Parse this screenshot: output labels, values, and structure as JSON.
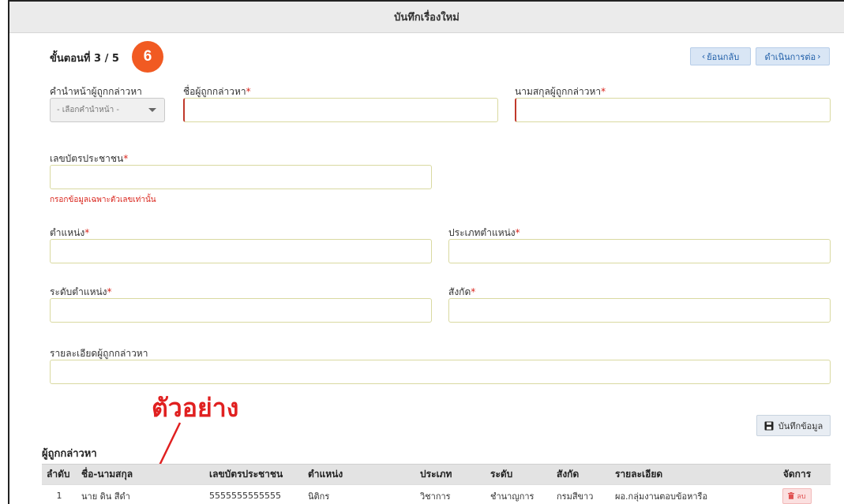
{
  "window": {
    "title": "บันทึกเรื่องใหม่"
  },
  "step": {
    "label": "ขั้นตอนที่ 3 / 5",
    "badge": "6"
  },
  "nav": {
    "back_label": "ย้อนกลับ",
    "next_label": "ดำเนินการต่อ"
  },
  "form": {
    "prefix_label": "คำนำหน้าผู้ถูกกล่าวหา",
    "prefix_placeholder": "- เลือกคำนำหน้า -",
    "firstname_label": "ชื่อผู้ถูกกล่าวหา",
    "lastname_label": "นามสกุลผู้ถูกกล่าวหา",
    "idcard_label": "เลขบัตรประชาชน",
    "idcard_hint": "กรอกข้อมูลเฉพาะตัวเลขเท่านั้น",
    "position_label": "ตำแหน่ง",
    "position_type_label": "ประเภทตำแหน่ง",
    "level_label": "ระดับตำแหน่ง",
    "affiliation_label": "สังกัด",
    "detail_label": "รายละเอียดผู้ถูกกล่าวหา",
    "required_mark": "*",
    "save_label": "บันทึกข้อมูล"
  },
  "annotation": {
    "text": "ตัวอย่าง",
    "color": "#e02020"
  },
  "accused": {
    "section_title": "ผู้ถูกกล่าวหา",
    "columns": [
      "ลำดับ",
      "ชื่อ-นามสกุล",
      "เลขบัตรประชาชน",
      "ตำแหน่ง",
      "ประเภท",
      "ระดับ",
      "สังกัด",
      "รายละเอียด",
      "จัดการ"
    ],
    "rows": [
      {
        "no": "1",
        "name": "นาย ดิน สีดำ",
        "idcard": "5555555555555",
        "position": "นิติกร",
        "type": "วิชาการ",
        "level": "ชำนาญการ",
        "affiliation": "กรมสีขาว",
        "detail": "ผอ.กลุ่มงานตอบข้อหารือ",
        "action": "ลบ"
      }
    ]
  },
  "colors": {
    "accent": "#f15a22",
    "required": "#d9241b",
    "nav_button": "#d9e6f5"
  }
}
